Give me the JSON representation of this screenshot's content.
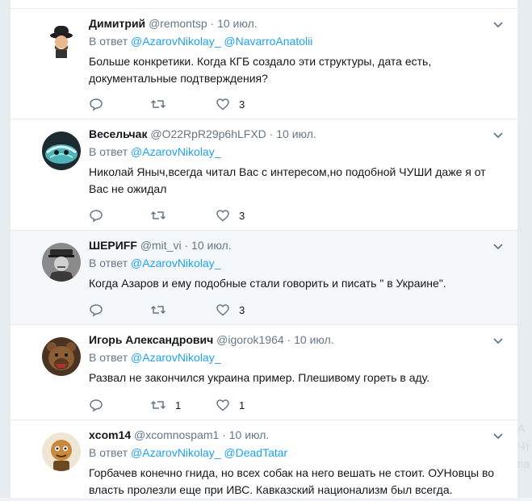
{
  "tweets": [
    {
      "name": "Димитрий",
      "handle": "@remontsp",
      "dot": "·",
      "date": "10 июл.",
      "reply_prefix": "В ответ",
      "mentions": [
        "@AzarovNikolay_",
        "@NavarroAnatolii"
      ],
      "text": "Больше конкретики. Когда КГБ создало эти структуры, дата есть, документальные подтверждения?",
      "reply_count": "",
      "retweet_count": "",
      "like_count": "3",
      "avatar_icon": "man-bowler-hat-avatar"
    },
    {
      "name": "Весельчак",
      "handle": "@O22RpR29p6hLFXD",
      "dot": "·",
      "date": "10 июл.",
      "reply_prefix": "В ответ",
      "mentions": [
        "@AzarovNikolay_"
      ],
      "text": "Николай Яныч,всегда читал Вас с интересом,но подобной ЧУШИ даже я от Вас не ожидал",
      "reply_count": "",
      "retweet_count": "",
      "like_count": "3",
      "avatar_icon": "teal-mask-avatar"
    },
    {
      "name": "ШЕРИFF",
      "handle": "@mit_vi",
      "dot": "·",
      "date": "10 июл.",
      "reply_prefix": "В ответ",
      "mentions": [
        "@AzarovNikolay_"
      ],
      "text": "Когда Азаров и ему подобные стали говорить и писать \" в Украине\".",
      "reply_count": "",
      "retweet_count": "",
      "like_count": "3",
      "avatar_icon": "officer-portrait-avatar"
    },
    {
      "name": "Игорь Александрович",
      "handle": "@igorok1964",
      "dot": "·",
      "date": "10 июл.",
      "reply_prefix": "В ответ",
      "mentions": [
        "@AzarovNikolay_"
      ],
      "text": "Развал не закончился украина пример. Плешивому гореть в аду.",
      "reply_count": "",
      "retweet_count": "1",
      "like_count": "1",
      "avatar_icon": "bear-avatar"
    },
    {
      "name": "xcom14",
      "handle": "@xcomnospam1",
      "dot": "·",
      "date": "10 июл.",
      "reply_prefix": "В ответ",
      "mentions": [
        "@AzarovNikolay_",
        "@DeadTatar"
      ],
      "text": "Горбачев конечно гнида, но всех собак на него вешать не стоит. ОУНовцы во власть пролезли еще при ИВС. Кавказский национализм был всегда.",
      "reply_count": "",
      "retweet_count": "",
      "like_count": "",
      "avatar_icon": "cartoon-character-avatar"
    }
  ],
  "side_ghost": [
    "A",
    "Чт",
    "па"
  ],
  "colors": {
    "link": "#1da1f2",
    "muted": "#657786",
    "highlight": "#f5f8fa"
  }
}
